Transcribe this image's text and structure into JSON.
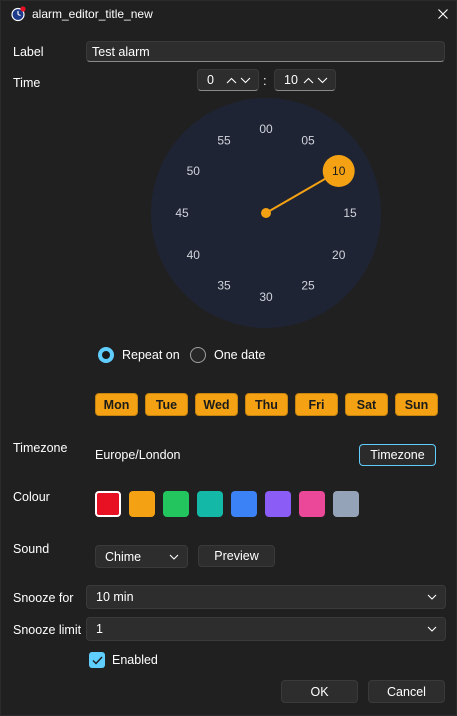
{
  "window": {
    "title": "alarm_editor_title_new"
  },
  "form": {
    "label_label": "Label",
    "label_value": "Test alarm",
    "time_label": "Time",
    "hour_value": "0",
    "minute_value": "10",
    "time_separator": ":",
    "timezone_label": "Timezone",
    "timezone_value": "Europe/London",
    "timezone_button": "Timezone",
    "colour_label": "Colour",
    "sound_label": "Sound",
    "sound_value": "Chime",
    "preview_button": "Preview",
    "snooze_for_label": "Snooze for",
    "snooze_for_value": "10 min",
    "snooze_limit_label": "Snooze limit",
    "snooze_limit_value": "1",
    "enabled_label": "Enabled"
  },
  "clock": {
    "selected_minute": 10,
    "accent_color": "#f4a213",
    "face_color": "#1f2434",
    "labels": [
      "00",
      "05",
      "10",
      "15",
      "20",
      "25",
      "30",
      "35",
      "40",
      "45",
      "50",
      "55"
    ]
  },
  "repeat": {
    "repeat_on_label": "Repeat on",
    "one_date_label": "One date",
    "selected": "repeat_on",
    "days": [
      "Mon",
      "Tue",
      "Wed",
      "Thu",
      "Fri",
      "Sat",
      "Sun"
    ]
  },
  "colours": {
    "selected_index": 0,
    "swatches": [
      "#e81123",
      "#f4a213",
      "#22c55e",
      "#14b8a6",
      "#3b82f6",
      "#8b5cf6",
      "#ec4899",
      "#94a3b8"
    ]
  },
  "actions": {
    "ok": "OK",
    "cancel": "Cancel"
  }
}
